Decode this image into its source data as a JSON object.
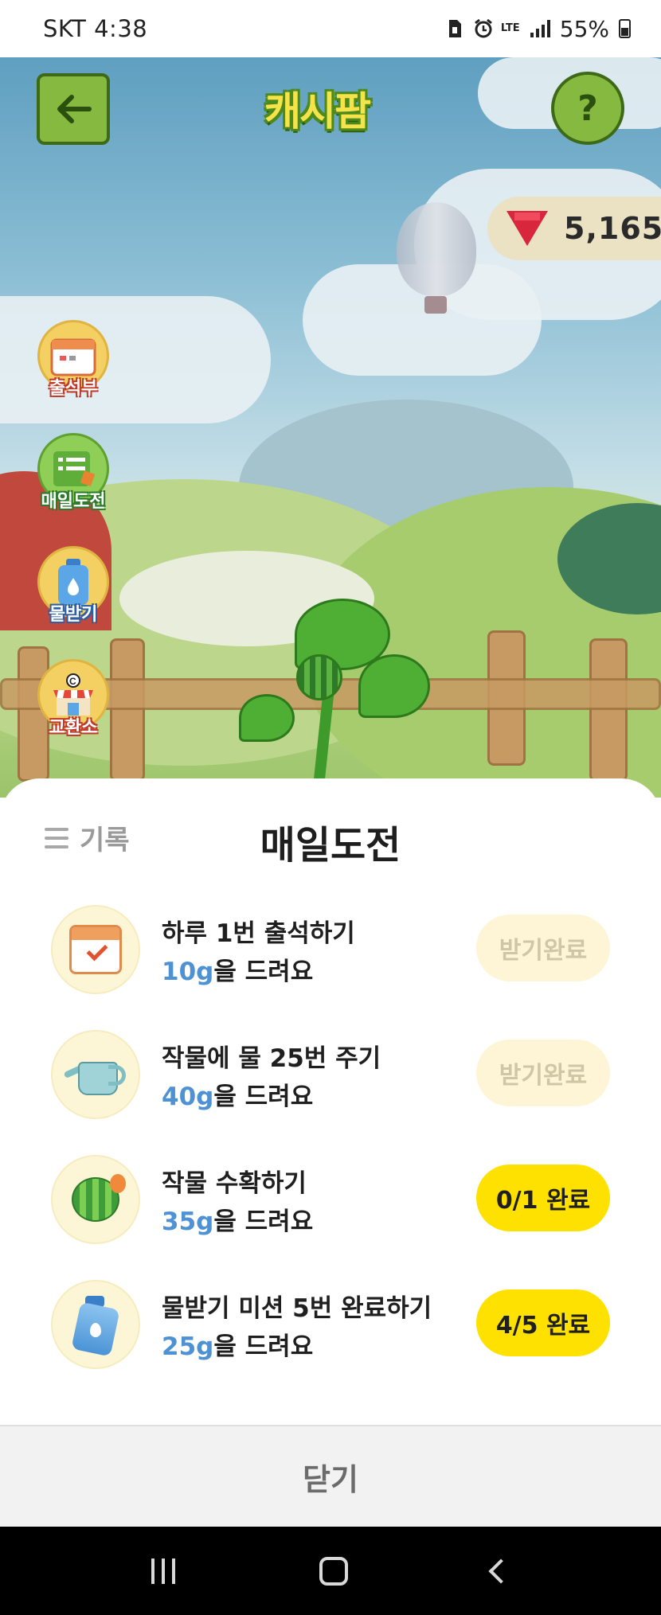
{
  "status_bar": {
    "carrier_time": "SKT 4:38",
    "network": "LTE",
    "battery": "55%"
  },
  "game": {
    "logo_text": "캐시팜",
    "gem_count": "5,165",
    "side_menu": [
      {
        "label": "출석부"
      },
      {
        "label": "매일도전"
      },
      {
        "label": "물받기"
      },
      {
        "label": "교환소"
      }
    ]
  },
  "sheet": {
    "history_label": "기록",
    "title": "매일도전",
    "missions": [
      {
        "title": "하루 1번 출석하기",
        "amount": "10g",
        "suffix": "을 드려요",
        "button": "받기완료",
        "state": "done"
      },
      {
        "title": "작물에 물 25번 주기",
        "amount": "40g",
        "suffix": "을 드려요",
        "button": "받기완료",
        "state": "done"
      },
      {
        "title": "작물 수확하기",
        "amount": "35g",
        "suffix": "을 드려요",
        "button": "0/1 완료",
        "state": "progress"
      },
      {
        "title": "물받기 미션 5번 완료하기",
        "amount": "25g",
        "suffix": "을 드려요",
        "button": "4/5 완료",
        "state": "progress"
      }
    ],
    "close_label": "닫기"
  },
  "colors": {
    "accent_yellow": "#ffe100",
    "reward_blue": "#4f92d3",
    "done_bg": "#fdf5d5"
  }
}
